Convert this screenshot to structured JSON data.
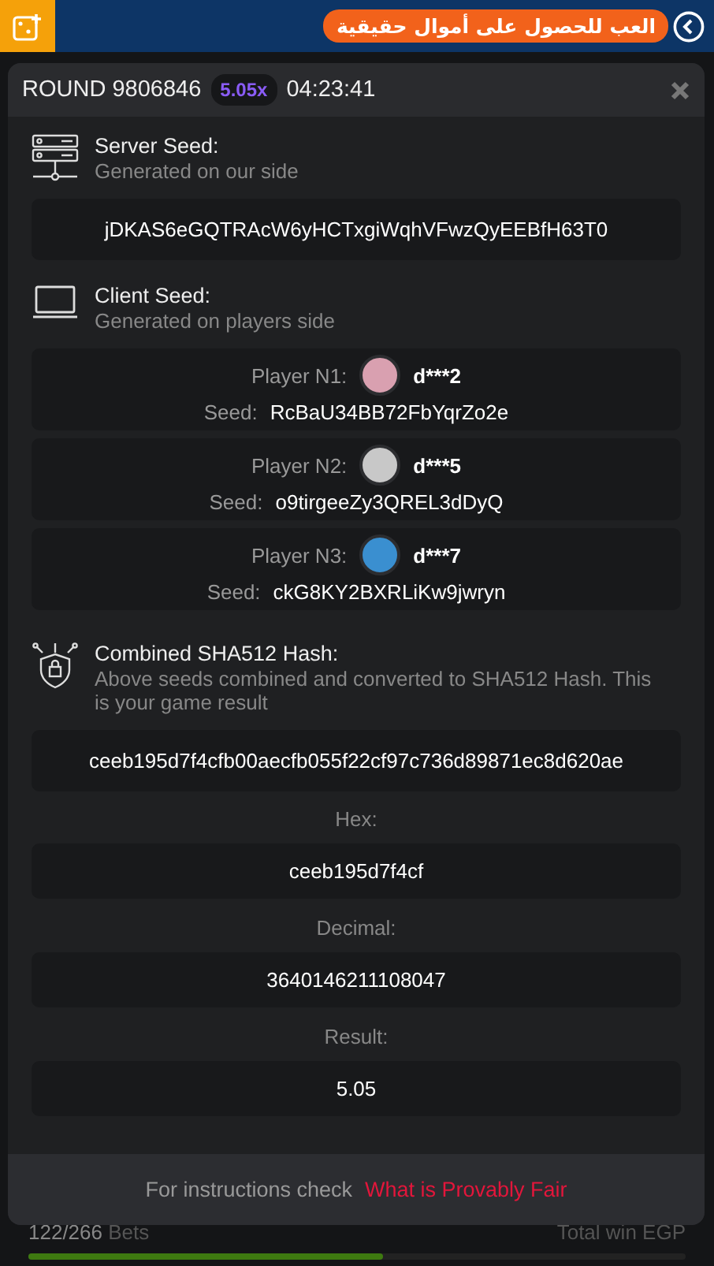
{
  "top_bar": {
    "promo": "العب للحصول على أموال حقيقية"
  },
  "modal": {
    "round": "ROUND 9806846",
    "multiplier": "5.05x",
    "time": "04:23:41",
    "server_seed": {
      "title": "Server Seed:",
      "subtitle": "Generated on our side",
      "value": "jDKAS6eGQTRAcW6yHCTxgiWqhVFwzQyEEBfH63T0"
    },
    "client_seed": {
      "title": "Client Seed:",
      "subtitle": "Generated on players side",
      "players": [
        {
          "label": "Player N1:",
          "name": "d***2",
          "seed_label": "Seed:",
          "seed": "RcBaU34BB72FbYqrZo2e",
          "color": "#d9a0b0"
        },
        {
          "label": "Player N2:",
          "name": "d***5",
          "seed_label": "Seed:",
          "seed": "o9tirgeeZy3QREL3dDyQ",
          "color": "#c8c8c8"
        },
        {
          "label": "Player N3:",
          "name": "d***7",
          "seed_label": "Seed:",
          "seed": "ckG8KY2BXRLiKw9jwryn",
          "color": "#3a8fd0"
        }
      ]
    },
    "hash": {
      "title": "Combined SHA512 Hash:",
      "subtitle": "Above seeds combined and converted to SHA512 Hash. This is your game result",
      "value": "ceeb195d7f4cfb00aecfb055f22cf97c736d89871ec8d620ae"
    },
    "fields": [
      {
        "label": "Hex:",
        "value": "ceeb195d7f4cf"
      },
      {
        "label": "Decimal:",
        "value": "3640146211108047"
      },
      {
        "label": "Result:",
        "value": "5.05"
      }
    ],
    "footer": {
      "text": "For instructions check",
      "link": "What is Provably Fair"
    }
  },
  "bottom": {
    "bets": "122/266",
    "bets_label": "Bets",
    "total": "Total win EGP",
    "level": 0.54
  }
}
